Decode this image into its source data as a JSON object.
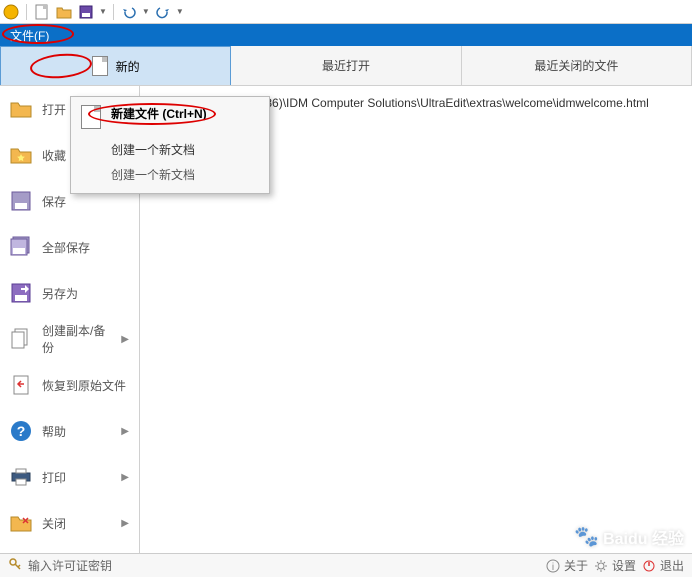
{
  "menu": {
    "file": "文件(F)"
  },
  "tabs": {
    "new": "新的",
    "recent_open": "最近打开",
    "recent_closed": "最近关闭的文件"
  },
  "sidebar": {
    "open": "打开",
    "favorites": "收藏",
    "save": "保存",
    "save_all": "全部保存",
    "save_as": "另存为",
    "create_copy": "创建副本/备份",
    "restore": "恢复到原始文件",
    "help": "帮助",
    "print": "打印",
    "close": "关闭"
  },
  "detail": {
    "recent_path": "1 C:\\Program Files (x86)\\IDM Computer Solutions\\UltraEdit\\extras\\welcome\\idmwelcome.html"
  },
  "popup": {
    "title": "新建文件 (Ctrl+N)",
    "line1": "创建一个新文档",
    "line2": "创建一个新文档"
  },
  "statusbar": {
    "license": "输入许可证密钥",
    "about": "关于",
    "settings": "设置",
    "exit": "退出"
  },
  "watermark": {
    "brand": "Baidu",
    "label": "经验"
  }
}
